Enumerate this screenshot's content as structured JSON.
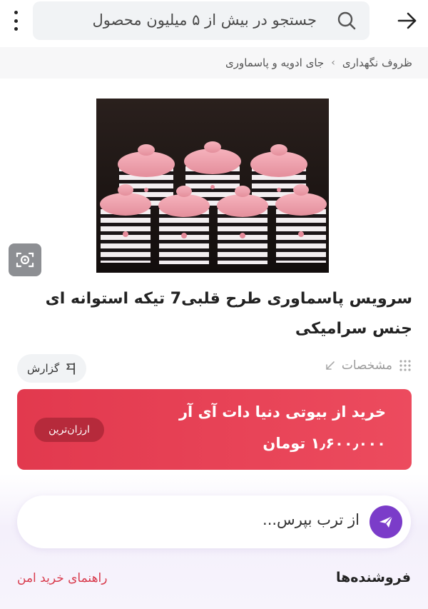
{
  "search": {
    "placeholder": "جستجو در بیش از ۵ میلیون محصول"
  },
  "breadcrumb": {
    "items": [
      "ظروف نگهداری",
      "جای ادویه و پاسماوری"
    ],
    "separator": "›"
  },
  "product": {
    "title": "سرویس پاسماوری طرح قلبی7 تیکه استوانه ای جنس سرامیکی"
  },
  "actions": {
    "report_label": "گزارش",
    "specs_label": "مشخصات"
  },
  "offer": {
    "shop_label": "خرید از بیوتی دنیا دات آی آر",
    "price": "۱٫۶۰۰٫۰۰۰ تومان",
    "badge": "ارزان‌ترین"
  },
  "ask": {
    "placeholder": "از ترب بپرس..."
  },
  "sellers": {
    "heading": "فروشنده‌ها",
    "safe_guide": "راهنمای خرید امن"
  },
  "icons": {
    "back": "arrow-right-icon",
    "search": "search-icon",
    "menu": "more-vertical-icon",
    "image_search": "camera-search-icon",
    "report": "flag-icon",
    "specs": "expand-icon",
    "specs_grid": "dots-grid-icon",
    "send": "send-icon"
  },
  "colors": {
    "accent_red": "#e2394e",
    "badge_dark_red": "#b62a3b",
    "purple": "#7b3cc9",
    "link_red": "#d83a4c"
  }
}
